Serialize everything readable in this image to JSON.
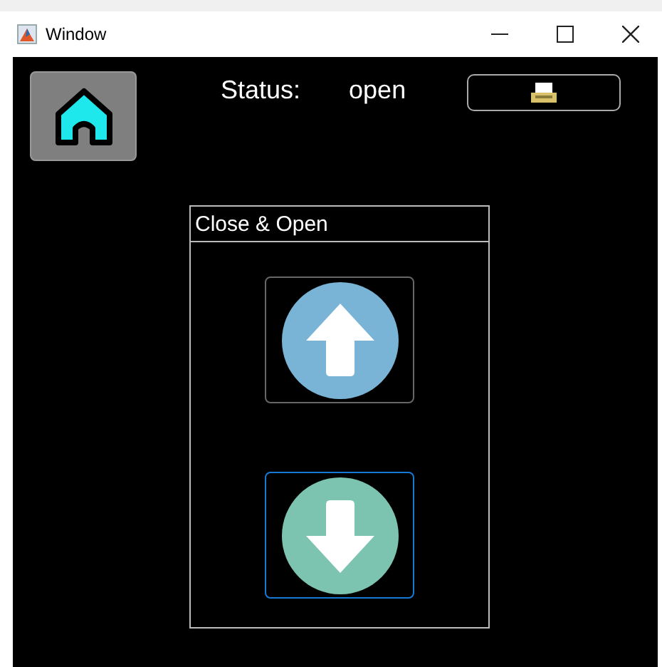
{
  "window": {
    "title": "Window"
  },
  "status": {
    "label": "Status:",
    "value": "open"
  },
  "panel": {
    "title": "Close & Open"
  },
  "arrow_buttons": [
    {
      "kind": "up",
      "focused": false
    },
    {
      "kind": "down",
      "focused": true
    }
  ]
}
